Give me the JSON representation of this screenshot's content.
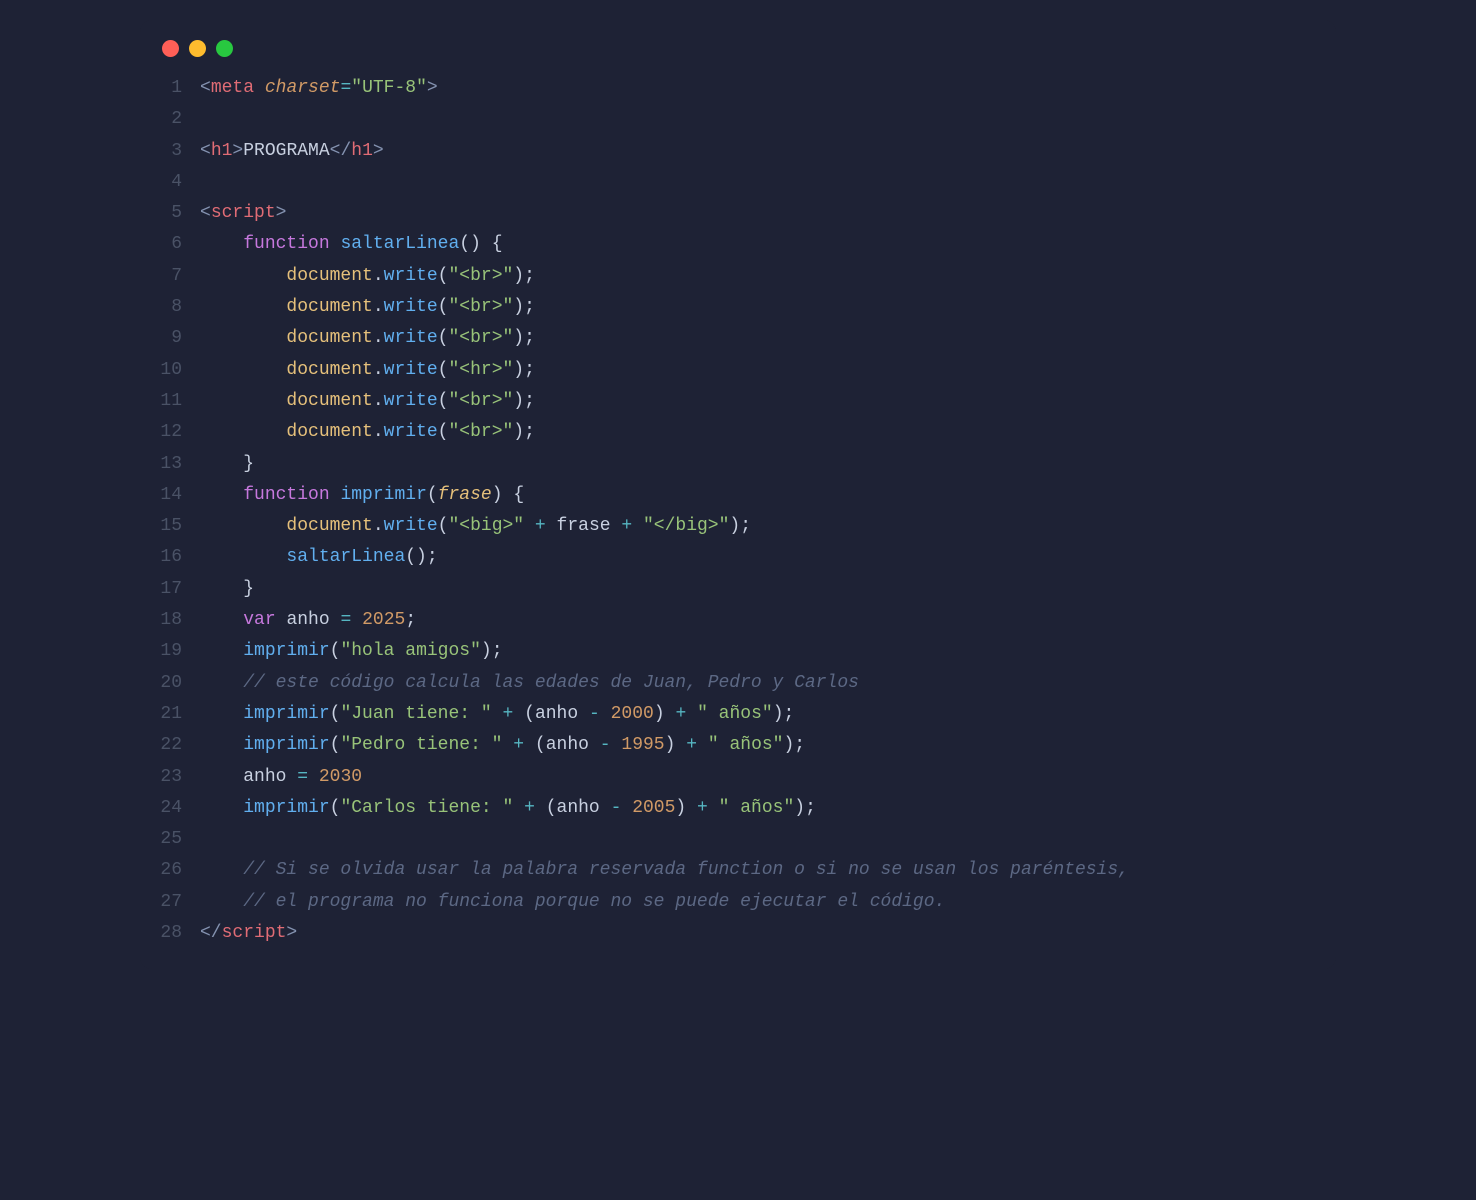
{
  "window": {
    "dots": [
      "red",
      "yellow",
      "green"
    ]
  },
  "gutter": [
    "1",
    "2",
    "3",
    "4",
    "5",
    "6",
    "7",
    "8",
    "9",
    "10",
    "11",
    "12",
    "13",
    "14",
    "15",
    "16",
    "17",
    "18",
    "19",
    "20",
    "21",
    "22",
    "23",
    "24",
    "25",
    "26",
    "27",
    "28"
  ],
  "code": {
    "l1": {
      "tag": "meta",
      "attr": "charset",
      "val": "\"UTF-8\""
    },
    "l3": {
      "open": "h1",
      "text": "PROGRAMA",
      "close": "h1"
    },
    "l5": {
      "tag": "script"
    },
    "l6": {
      "kw": "function",
      "name": "saltarLinea"
    },
    "l7": {
      "obj": "document",
      "fn": "write",
      "arg": "\"<br>\""
    },
    "l8": {
      "obj": "document",
      "fn": "write",
      "arg": "\"<br>\""
    },
    "l9": {
      "obj": "document",
      "fn": "write",
      "arg": "\"<br>\""
    },
    "l10": {
      "obj": "document",
      "fn": "write",
      "arg": "\"<hr>\""
    },
    "l11": {
      "obj": "document",
      "fn": "write",
      "arg": "\"<br>\""
    },
    "l12": {
      "obj": "document",
      "fn": "write",
      "arg": "\"<br>\""
    },
    "l14": {
      "kw": "function",
      "name": "imprimir",
      "param": "frase"
    },
    "l15": {
      "obj": "document",
      "fn": "write",
      "s1": "\"<big>\"",
      "id": "frase",
      "s2": "\"</big>\""
    },
    "l16": {
      "fn": "saltarLinea"
    },
    "l18": {
      "kw": "var",
      "id": "anho",
      "val": "2025"
    },
    "l19": {
      "fn": "imprimir",
      "arg": "\"hola amigos\""
    },
    "l20": {
      "c": "// este código calcula las edades de Juan, Pedro y Carlos"
    },
    "l21": {
      "fn": "imprimir",
      "s1": "\"Juan tiene: \"",
      "id": "anho",
      "n": "2000",
      "s2": "\" años\""
    },
    "l22": {
      "fn": "imprimir",
      "s1": "\"Pedro tiene: \"",
      "id": "anho",
      "n": "1995",
      "s2": "\" años\""
    },
    "l23": {
      "id": "anho",
      "val": "2030"
    },
    "l24": {
      "fn": "imprimir",
      "s1": "\"Carlos tiene: \"",
      "id": "anho",
      "n": "2005",
      "s2": "\" años\""
    },
    "l26": {
      "c": "// Si se olvida usar la palabra reservada function o si no se usan los paréntesis,"
    },
    "l27": {
      "c": "// el programa no funciona porque no se puede ejecutar el código."
    },
    "l28": {
      "tag": "script"
    }
  }
}
